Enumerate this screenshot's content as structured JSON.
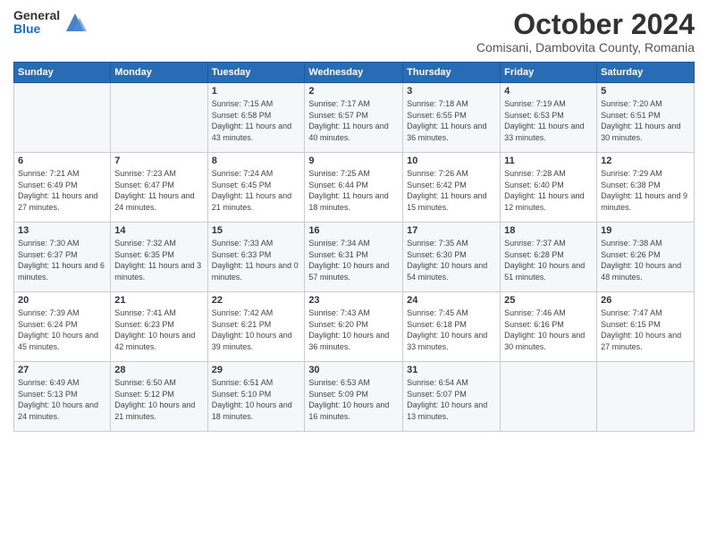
{
  "logo": {
    "general": "General",
    "blue": "Blue"
  },
  "header": {
    "month": "October 2024",
    "location": "Comisani, Dambovita County, Romania"
  },
  "weekdays": [
    "Sunday",
    "Monday",
    "Tuesday",
    "Wednesday",
    "Thursday",
    "Friday",
    "Saturday"
  ],
  "weeks": [
    [
      {
        "day": "",
        "info": ""
      },
      {
        "day": "",
        "info": ""
      },
      {
        "day": "1",
        "info": "Sunrise: 7:15 AM\nSunset: 6:58 PM\nDaylight: 11 hours and 43 minutes."
      },
      {
        "day": "2",
        "info": "Sunrise: 7:17 AM\nSunset: 6:57 PM\nDaylight: 11 hours and 40 minutes."
      },
      {
        "day": "3",
        "info": "Sunrise: 7:18 AM\nSunset: 6:55 PM\nDaylight: 11 hours and 36 minutes."
      },
      {
        "day": "4",
        "info": "Sunrise: 7:19 AM\nSunset: 6:53 PM\nDaylight: 11 hours and 33 minutes."
      },
      {
        "day": "5",
        "info": "Sunrise: 7:20 AM\nSunset: 6:51 PM\nDaylight: 11 hours and 30 minutes."
      }
    ],
    [
      {
        "day": "6",
        "info": "Sunrise: 7:21 AM\nSunset: 6:49 PM\nDaylight: 11 hours and 27 minutes."
      },
      {
        "day": "7",
        "info": "Sunrise: 7:23 AM\nSunset: 6:47 PM\nDaylight: 11 hours and 24 minutes."
      },
      {
        "day": "8",
        "info": "Sunrise: 7:24 AM\nSunset: 6:45 PM\nDaylight: 11 hours and 21 minutes."
      },
      {
        "day": "9",
        "info": "Sunrise: 7:25 AM\nSunset: 6:44 PM\nDaylight: 11 hours and 18 minutes."
      },
      {
        "day": "10",
        "info": "Sunrise: 7:26 AM\nSunset: 6:42 PM\nDaylight: 11 hours and 15 minutes."
      },
      {
        "day": "11",
        "info": "Sunrise: 7:28 AM\nSunset: 6:40 PM\nDaylight: 11 hours and 12 minutes."
      },
      {
        "day": "12",
        "info": "Sunrise: 7:29 AM\nSunset: 6:38 PM\nDaylight: 11 hours and 9 minutes."
      }
    ],
    [
      {
        "day": "13",
        "info": "Sunrise: 7:30 AM\nSunset: 6:37 PM\nDaylight: 11 hours and 6 minutes."
      },
      {
        "day": "14",
        "info": "Sunrise: 7:32 AM\nSunset: 6:35 PM\nDaylight: 11 hours and 3 minutes."
      },
      {
        "day": "15",
        "info": "Sunrise: 7:33 AM\nSunset: 6:33 PM\nDaylight: 11 hours and 0 minutes."
      },
      {
        "day": "16",
        "info": "Sunrise: 7:34 AM\nSunset: 6:31 PM\nDaylight: 10 hours and 57 minutes."
      },
      {
        "day": "17",
        "info": "Sunrise: 7:35 AM\nSunset: 6:30 PM\nDaylight: 10 hours and 54 minutes."
      },
      {
        "day": "18",
        "info": "Sunrise: 7:37 AM\nSunset: 6:28 PM\nDaylight: 10 hours and 51 minutes."
      },
      {
        "day": "19",
        "info": "Sunrise: 7:38 AM\nSunset: 6:26 PM\nDaylight: 10 hours and 48 minutes."
      }
    ],
    [
      {
        "day": "20",
        "info": "Sunrise: 7:39 AM\nSunset: 6:24 PM\nDaylight: 10 hours and 45 minutes."
      },
      {
        "day": "21",
        "info": "Sunrise: 7:41 AM\nSunset: 6:23 PM\nDaylight: 10 hours and 42 minutes."
      },
      {
        "day": "22",
        "info": "Sunrise: 7:42 AM\nSunset: 6:21 PM\nDaylight: 10 hours and 39 minutes."
      },
      {
        "day": "23",
        "info": "Sunrise: 7:43 AM\nSunset: 6:20 PM\nDaylight: 10 hours and 36 minutes."
      },
      {
        "day": "24",
        "info": "Sunrise: 7:45 AM\nSunset: 6:18 PM\nDaylight: 10 hours and 33 minutes."
      },
      {
        "day": "25",
        "info": "Sunrise: 7:46 AM\nSunset: 6:16 PM\nDaylight: 10 hours and 30 minutes."
      },
      {
        "day": "26",
        "info": "Sunrise: 7:47 AM\nSunset: 6:15 PM\nDaylight: 10 hours and 27 minutes."
      }
    ],
    [
      {
        "day": "27",
        "info": "Sunrise: 6:49 AM\nSunset: 5:13 PM\nDaylight: 10 hours and 24 minutes."
      },
      {
        "day": "28",
        "info": "Sunrise: 6:50 AM\nSunset: 5:12 PM\nDaylight: 10 hours and 21 minutes."
      },
      {
        "day": "29",
        "info": "Sunrise: 6:51 AM\nSunset: 5:10 PM\nDaylight: 10 hours and 18 minutes."
      },
      {
        "day": "30",
        "info": "Sunrise: 6:53 AM\nSunset: 5:09 PM\nDaylight: 10 hours and 16 minutes."
      },
      {
        "day": "31",
        "info": "Sunrise: 6:54 AM\nSunset: 5:07 PM\nDaylight: 10 hours and 13 minutes."
      },
      {
        "day": "",
        "info": ""
      },
      {
        "day": "",
        "info": ""
      }
    ]
  ]
}
